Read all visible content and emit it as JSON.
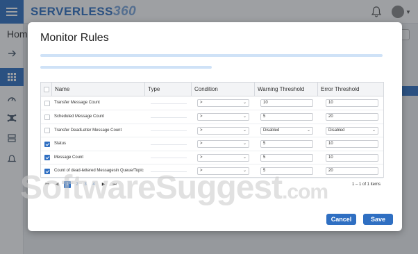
{
  "app": {
    "logo_text": "SERVERLESS",
    "logo_num": "360",
    "breadcrumb": "Home"
  },
  "modal": {
    "title": "Monitor Rules",
    "columns": [
      "Name",
      "Type",
      "Condition",
      "Warning Threshold",
      "Error Threshold"
    ],
    "rows": [
      {
        "checked": false,
        "name": "Transfer Message Count",
        "condition": ">",
        "warning": "10",
        "warning_is_select": false,
        "error": "10",
        "error_is_select": false
      },
      {
        "checked": false,
        "name": "Scheduled Message Count",
        "condition": ">",
        "warning": "5",
        "warning_is_select": false,
        "error": "20",
        "error_is_select": false
      },
      {
        "checked": false,
        "name": "Transfer DeadLetter Message Count",
        "condition": ">",
        "warning": "Disabled",
        "warning_is_select": true,
        "error": "Disabled",
        "error_is_select": true
      },
      {
        "checked": true,
        "name": "Status",
        "condition": ">",
        "warning": "5",
        "warning_is_select": false,
        "error": "10",
        "error_is_select": false
      },
      {
        "checked": true,
        "name": "Message Count",
        "condition": ">",
        "warning": "5",
        "warning_is_select": false,
        "error": "10",
        "error_is_select": false
      },
      {
        "checked": true,
        "name": "Count of dead-lettered Messagesin Queue/Topic",
        "condition": ">",
        "warning": "5",
        "warning_is_select": false,
        "error": "20",
        "error_is_select": false
      }
    ],
    "pagination": {
      "first": "⏮",
      "prev": "◀",
      "pages": [
        "1",
        "2",
        "3",
        "4"
      ],
      "current": "1",
      "next": "▶",
      "last": "⏭",
      "info": "1 – 1 of 1 items"
    },
    "cancel_label": "Cancel",
    "save_label": "Save"
  },
  "watermark": {
    "text": "SoftwareSuggest",
    "suffix": ".com"
  },
  "colors": {
    "accent": "#2f6fc2",
    "overlay": "#8f9196"
  }
}
